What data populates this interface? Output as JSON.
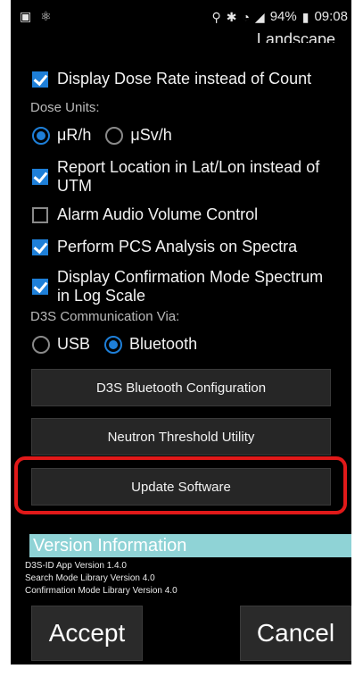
{
  "status_bar": {
    "left_icons": [
      "gallery-icon",
      "atom-icon"
    ],
    "battery_text": "94%",
    "time": "09:08",
    "right_icons": [
      "location-pin-icon",
      "bluetooth-icon",
      "wifi-icon",
      "signal-icon",
      "battery-icon"
    ]
  },
  "top_partial_text": "Landscape",
  "options": {
    "display_dose_rate": {
      "label": "Display Dose Rate instead of Count",
      "checked": true
    },
    "dose_units_label": "Dose Units:",
    "dose_units": [
      {
        "label": "μR/h",
        "selected": true
      },
      {
        "label": "μSv/h",
        "selected": false
      }
    ],
    "report_location": {
      "label": "Report Location in Lat/Lon instead of UTM",
      "checked": true
    },
    "alarm_audio": {
      "label": "Alarm Audio Volume Control",
      "checked": false
    },
    "perform_pcs": {
      "label": "Perform PCS Analysis on Spectra",
      "checked": true
    },
    "display_confirmation": {
      "label": "Display Confirmation Mode Spectrum in Log Scale",
      "checked": true
    },
    "comm_label": "D3S Communication Via:",
    "comm_options": [
      {
        "label": "USB",
        "selected": false
      },
      {
        "label": "Bluetooth",
        "selected": true
      }
    ]
  },
  "buttons": {
    "bluetooth_config": "D3S Bluetooth Configuration",
    "neutron_threshold": "Neutron Threshold Utility",
    "update_software": "Update Software"
  },
  "version": {
    "title": "Version Information",
    "lines": [
      "D3S-ID App Version 1.4.0",
      "Search Mode Library Version 4.0",
      "Confirmation Mode Library Version 4.0"
    ]
  },
  "footer": {
    "accept": "Accept",
    "cancel": "Cancel"
  },
  "colors": {
    "accent_blue": "#1e7fd8",
    "highlight_red": "#e11919",
    "version_bar": "#8fd3d6",
    "background": "#000000"
  }
}
